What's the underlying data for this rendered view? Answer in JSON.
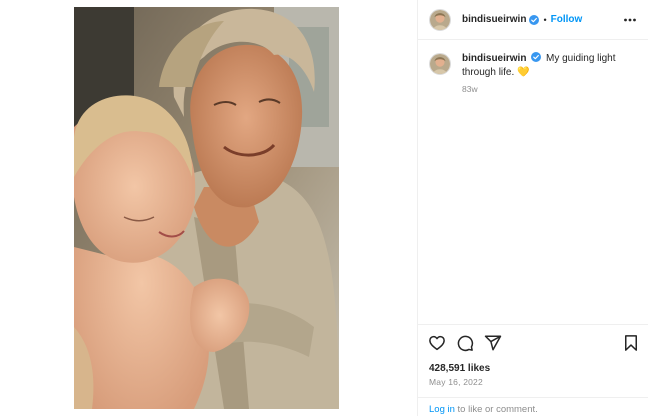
{
  "header": {
    "username": "bindisueirwin",
    "separator": "•",
    "follow_label": "Follow"
  },
  "caption": {
    "username": "bindisueirwin",
    "text": "My guiding light through life. 💛",
    "time_ago": "83w"
  },
  "engagement": {
    "likes": "428,591 likes",
    "date": "May 16, 2022"
  },
  "login_prompt": {
    "link_text": "Log in",
    "rest_text": " to like or comment."
  },
  "icons": {
    "verified": "verified-badge-icon",
    "more": "more-options-icon",
    "like": "heart-icon",
    "comment": "comment-icon",
    "share": "share-icon",
    "save": "bookmark-icon"
  },
  "colors": {
    "accent": "#0095f6",
    "verified": "#3897f0",
    "text": "#262626",
    "muted": "#8e8e8e"
  }
}
